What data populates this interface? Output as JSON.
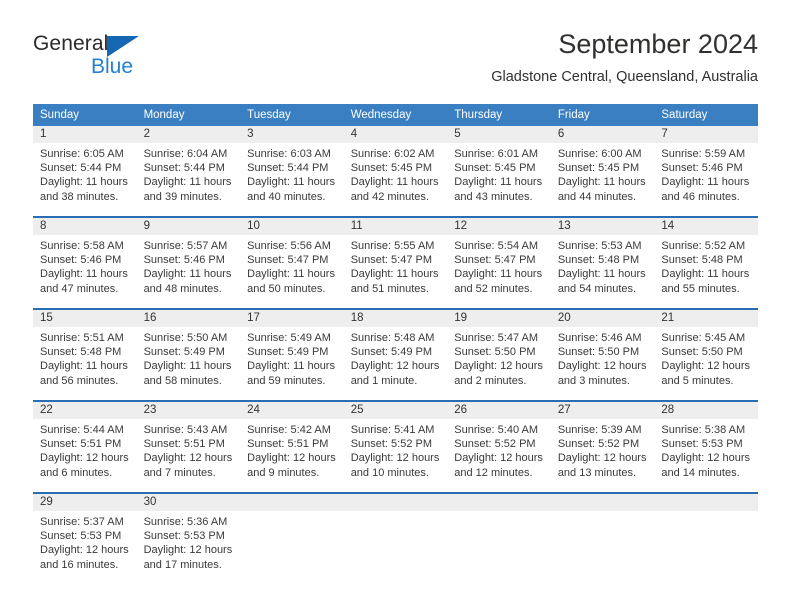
{
  "brand": {
    "name_top": "General",
    "name_bottom": "Blue",
    "accent_color": "#1567b2",
    "accent_color_light": "#2480d4"
  },
  "header": {
    "title": "September 2024",
    "subtitle": "Gladstone Central, Queensland, Australia"
  },
  "theme": {
    "header_row_bg": "#3a7fc1",
    "week_separator": "#2a6db3",
    "daynum_band_bg": "#eeeeee",
    "text_color": "#3a3a3a"
  },
  "weekday_headers": [
    "Sunday",
    "Monday",
    "Tuesday",
    "Wednesday",
    "Thursday",
    "Friday",
    "Saturday"
  ],
  "weeks": [
    [
      {
        "day": "1",
        "sunrise": "Sunrise: 6:05 AM",
        "sunset": "Sunset: 5:44 PM",
        "daylight": "Daylight: 11 hours and 38 minutes."
      },
      {
        "day": "2",
        "sunrise": "Sunrise: 6:04 AM",
        "sunset": "Sunset: 5:44 PM",
        "daylight": "Daylight: 11 hours and 39 minutes."
      },
      {
        "day": "3",
        "sunrise": "Sunrise: 6:03 AM",
        "sunset": "Sunset: 5:44 PM",
        "daylight": "Daylight: 11 hours and 40 minutes."
      },
      {
        "day": "4",
        "sunrise": "Sunrise: 6:02 AM",
        "sunset": "Sunset: 5:45 PM",
        "daylight": "Daylight: 11 hours and 42 minutes."
      },
      {
        "day": "5",
        "sunrise": "Sunrise: 6:01 AM",
        "sunset": "Sunset: 5:45 PM",
        "daylight": "Daylight: 11 hours and 43 minutes."
      },
      {
        "day": "6",
        "sunrise": "Sunrise: 6:00 AM",
        "sunset": "Sunset: 5:45 PM",
        "daylight": "Daylight: 11 hours and 44 minutes."
      },
      {
        "day": "7",
        "sunrise": "Sunrise: 5:59 AM",
        "sunset": "Sunset: 5:46 PM",
        "daylight": "Daylight: 11 hours and 46 minutes."
      }
    ],
    [
      {
        "day": "8",
        "sunrise": "Sunrise: 5:58 AM",
        "sunset": "Sunset: 5:46 PM",
        "daylight": "Daylight: 11 hours and 47 minutes."
      },
      {
        "day": "9",
        "sunrise": "Sunrise: 5:57 AM",
        "sunset": "Sunset: 5:46 PM",
        "daylight": "Daylight: 11 hours and 48 minutes."
      },
      {
        "day": "10",
        "sunrise": "Sunrise: 5:56 AM",
        "sunset": "Sunset: 5:47 PM",
        "daylight": "Daylight: 11 hours and 50 minutes."
      },
      {
        "day": "11",
        "sunrise": "Sunrise: 5:55 AM",
        "sunset": "Sunset: 5:47 PM",
        "daylight": "Daylight: 11 hours and 51 minutes."
      },
      {
        "day": "12",
        "sunrise": "Sunrise: 5:54 AM",
        "sunset": "Sunset: 5:47 PM",
        "daylight": "Daylight: 11 hours and 52 minutes."
      },
      {
        "day": "13",
        "sunrise": "Sunrise: 5:53 AM",
        "sunset": "Sunset: 5:48 PM",
        "daylight": "Daylight: 11 hours and 54 minutes."
      },
      {
        "day": "14",
        "sunrise": "Sunrise: 5:52 AM",
        "sunset": "Sunset: 5:48 PM",
        "daylight": "Daylight: 11 hours and 55 minutes."
      }
    ],
    [
      {
        "day": "15",
        "sunrise": "Sunrise: 5:51 AM",
        "sunset": "Sunset: 5:48 PM",
        "daylight": "Daylight: 11 hours and 56 minutes."
      },
      {
        "day": "16",
        "sunrise": "Sunrise: 5:50 AM",
        "sunset": "Sunset: 5:49 PM",
        "daylight": "Daylight: 11 hours and 58 minutes."
      },
      {
        "day": "17",
        "sunrise": "Sunrise: 5:49 AM",
        "sunset": "Sunset: 5:49 PM",
        "daylight": "Daylight: 11 hours and 59 minutes."
      },
      {
        "day": "18",
        "sunrise": "Sunrise: 5:48 AM",
        "sunset": "Sunset: 5:49 PM",
        "daylight": "Daylight: 12 hours and 1 minute."
      },
      {
        "day": "19",
        "sunrise": "Sunrise: 5:47 AM",
        "sunset": "Sunset: 5:50 PM",
        "daylight": "Daylight: 12 hours and 2 minutes."
      },
      {
        "day": "20",
        "sunrise": "Sunrise: 5:46 AM",
        "sunset": "Sunset: 5:50 PM",
        "daylight": "Daylight: 12 hours and 3 minutes."
      },
      {
        "day": "21",
        "sunrise": "Sunrise: 5:45 AM",
        "sunset": "Sunset: 5:50 PM",
        "daylight": "Daylight: 12 hours and 5 minutes."
      }
    ],
    [
      {
        "day": "22",
        "sunrise": "Sunrise: 5:44 AM",
        "sunset": "Sunset: 5:51 PM",
        "daylight": "Daylight: 12 hours and 6 minutes."
      },
      {
        "day": "23",
        "sunrise": "Sunrise: 5:43 AM",
        "sunset": "Sunset: 5:51 PM",
        "daylight": "Daylight: 12 hours and 7 minutes."
      },
      {
        "day": "24",
        "sunrise": "Sunrise: 5:42 AM",
        "sunset": "Sunset: 5:51 PM",
        "daylight": "Daylight: 12 hours and 9 minutes."
      },
      {
        "day": "25",
        "sunrise": "Sunrise: 5:41 AM",
        "sunset": "Sunset: 5:52 PM",
        "daylight": "Daylight: 12 hours and 10 minutes."
      },
      {
        "day": "26",
        "sunrise": "Sunrise: 5:40 AM",
        "sunset": "Sunset: 5:52 PM",
        "daylight": "Daylight: 12 hours and 12 minutes."
      },
      {
        "day": "27",
        "sunrise": "Sunrise: 5:39 AM",
        "sunset": "Sunset: 5:52 PM",
        "daylight": "Daylight: 12 hours and 13 minutes."
      },
      {
        "day": "28",
        "sunrise": "Sunrise: 5:38 AM",
        "sunset": "Sunset: 5:53 PM",
        "daylight": "Daylight: 12 hours and 14 minutes."
      }
    ],
    [
      {
        "day": "29",
        "sunrise": "Sunrise: 5:37 AM",
        "sunset": "Sunset: 5:53 PM",
        "daylight": "Daylight: 12 hours and 16 minutes."
      },
      {
        "day": "30",
        "sunrise": "Sunrise: 5:36 AM",
        "sunset": "Sunset: 5:53 PM",
        "daylight": "Daylight: 12 hours and 17 minutes."
      },
      {
        "day": "",
        "sunrise": "",
        "sunset": "",
        "daylight": ""
      },
      {
        "day": "",
        "sunrise": "",
        "sunset": "",
        "daylight": ""
      },
      {
        "day": "",
        "sunrise": "",
        "sunset": "",
        "daylight": ""
      },
      {
        "day": "",
        "sunrise": "",
        "sunset": "",
        "daylight": ""
      },
      {
        "day": "",
        "sunrise": "",
        "sunset": "",
        "daylight": ""
      }
    ]
  ]
}
